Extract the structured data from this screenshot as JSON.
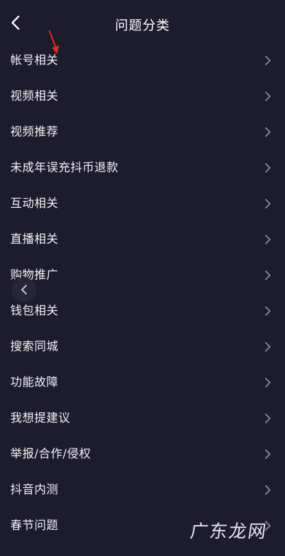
{
  "header": {
    "title": "问题分类",
    "back_icon": "chevron-left-icon"
  },
  "categories": [
    {
      "label": "帐号相关"
    },
    {
      "label": "视频相关"
    },
    {
      "label": "视频推荐"
    },
    {
      "label": "未成年误充抖币退款"
    },
    {
      "label": "互动相关"
    },
    {
      "label": "直播相关"
    },
    {
      "label": "购物推广"
    },
    {
      "label": "钱包相关"
    },
    {
      "label": "搜索同城"
    },
    {
      "label": "功能故障"
    },
    {
      "label": "我想提建议"
    },
    {
      "label": "举报/合作/侵权"
    },
    {
      "label": "抖音内测"
    },
    {
      "label": "春节问题"
    }
  ],
  "row_icon": "chevron-right-icon",
  "annotation_color": "#e8251f",
  "watermark": "广东龙网",
  "colors": {
    "background": "#1d1c2d",
    "text": "#f2f2f5",
    "chevron": "#8e8d9a"
  }
}
